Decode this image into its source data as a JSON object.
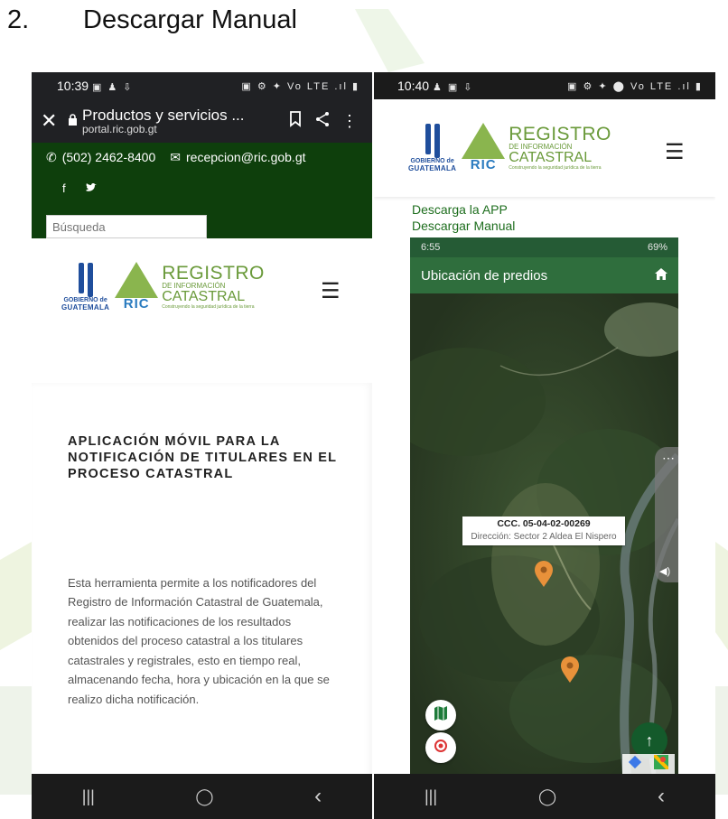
{
  "heading": {
    "number": "2.",
    "title": "Descargar Manual"
  },
  "left_phone": {
    "status": {
      "time": "10:39",
      "icons": "▣ ♟ ⇩",
      "right_icons": "▣ ⚙ ✦ Vo LTE .ıl ▮"
    },
    "browser": {
      "title": "Productos y servicios ...",
      "url": "portal.ric.gob.gt"
    },
    "contact": {
      "phone": "(502) 2462-8400",
      "email": "recepcion@ric.gob.gt"
    },
    "social": {
      "facebook": "f",
      "twitter": "🐦"
    },
    "search": {
      "placeholder": "Búsqueda"
    },
    "logo": {
      "gov_line1": "GOBIERNO de",
      "gov_line2": "GUATEMALA",
      "ric_line1": "REGISTRO",
      "ric_line2": "DE INFORMACIÓN",
      "ric_line3": "CATASTRAL",
      "ric_word": "RIC",
      "tagline": "Construyendo la seguridad jurídica de la tierra"
    },
    "app_title": "APLICACIÓN MÓVIL PARA LA NOTIFICACIÓN DE TITULARES EN EL PROCESO CATASTRAL",
    "app_description": "Esta herramienta permite a los notificadores del Registro de Información Catastral de Guatemala, realizar las notificaciones de los resultados obtenidos del proceso catastral a los titulares catastrales y registrales, esto en tiempo real, almacenando fecha, hora y ubicación en la que se realizo dicha notificación."
  },
  "right_phone": {
    "status": {
      "time": "10:40",
      "icons": "♟ ▣ ⇩",
      "right_icons": "▣ ⚙ ✦ ⬤ Vo LTE .ıl ▮"
    },
    "links": {
      "download_app": "Descarga la APP",
      "download_manual": "Descargar Manual"
    },
    "inner": {
      "status_time": "6:55",
      "status_right": "69%",
      "app_bar_title": "Ubicación de predios",
      "callout_code": "CCC. 05-04-02-00269",
      "callout_address": "Dirección: Sector 2 Aldea El Nispero"
    }
  },
  "nav": {
    "recents": "|||",
    "home": "◯",
    "back": "‹"
  },
  "colors": {
    "dark_green": "#0e3f0c",
    "app_green": "#2f6e3d",
    "pin_orange": "#e8913a",
    "logo_blue": "#1f4e9c",
    "logo_green": "#6a9a3a"
  },
  "icons": [
    "close-icon",
    "lock-icon",
    "bookmark-icon",
    "share-icon",
    "more-icon",
    "phone-icon",
    "mail-icon",
    "hamburger-menu-icon",
    "home-icon",
    "map-icon",
    "location-target-icon",
    "arrow-up-icon",
    "map-pin-icon"
  ]
}
